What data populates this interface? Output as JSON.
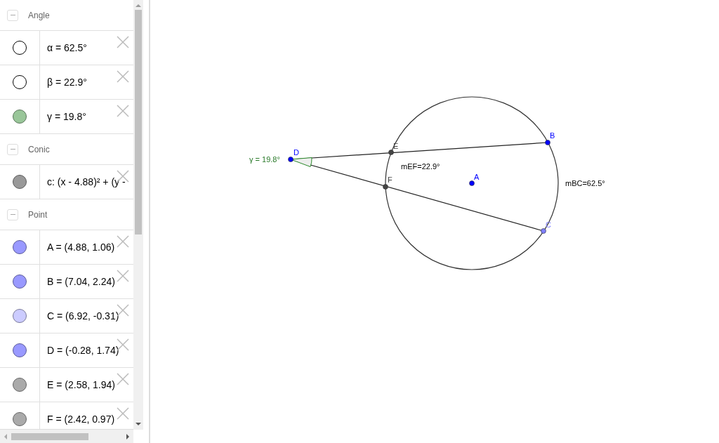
{
  "algebra": {
    "groups": [
      {
        "title": "Angle",
        "expanded": true,
        "items": [
          {
            "text": "α = 62.5°",
            "visible": false
          },
          {
            "text": "β = 22.9°",
            "visible": false
          },
          {
            "text": "γ = 19.8°",
            "visible": true,
            "color": "#99c699"
          }
        ]
      },
      {
        "title": "Conic",
        "expanded": true,
        "items": [
          {
            "text": "c: (x - 4.88)² + (y -",
            "visible": true,
            "color": "#999999"
          }
        ]
      },
      {
        "title": "Point",
        "expanded": true,
        "items": [
          {
            "text": "A = (4.88, 1.06)",
            "visible": true,
            "color": "#9999ff"
          },
          {
            "text": "B = (7.04, 2.24)",
            "visible": true,
            "color": "#9999ff"
          },
          {
            "text": "C = (6.92, -0.31)",
            "visible": true,
            "color": "#ccccff"
          },
          {
            "text": "D = (-0.28, 1.74)",
            "visible": true,
            "color": "#9999ff"
          },
          {
            "text": "E = (2.58, 1.94)",
            "visible": true,
            "color": "#aaaaaa"
          },
          {
            "text": "F = (2.42, 0.97)",
            "visible": true,
            "color": "#aaaaaa"
          }
        ]
      }
    ]
  },
  "canvas": {
    "points": [
      {
        "label": "D",
        "color": "#0000ff"
      },
      {
        "label": "E",
        "color": "#444444"
      },
      {
        "label": "F",
        "color": "#444444"
      },
      {
        "label": "A",
        "color": "#0000ff"
      },
      {
        "label": "B",
        "color": "#0000ff"
      },
      {
        "label": "C",
        "color": "#7f7fff"
      }
    ],
    "angle_label": "γ = 19.8°",
    "texts": [
      "mEF=22.9°",
      "mBC=62.5°"
    ]
  }
}
